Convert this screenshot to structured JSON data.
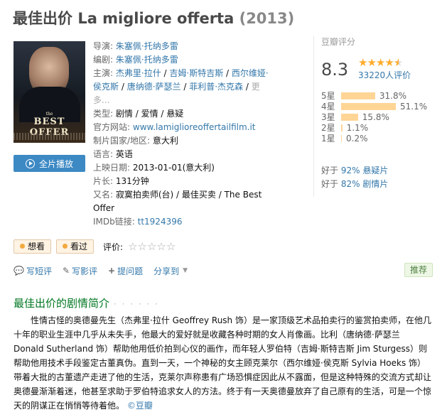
{
  "title": {
    "cn": "最佳出价",
    "original": "La migliore offerta",
    "year": "(2013)"
  },
  "poster": {
    "title_small": "the",
    "title_big": "BEST OFFER"
  },
  "play_button": "全片播放",
  "info": {
    "director_label": "导演:",
    "director": "朱塞佩·托纳多雷",
    "writer_label": "编剧:",
    "writer": "朱塞佩·托纳多雷",
    "cast_label": "主演:",
    "cast": [
      "杰弗里·拉什",
      "吉姆·斯特吉斯",
      "西尔维娅·侯克斯",
      "唐纳德·萨瑟兰",
      "菲利普·杰克森"
    ],
    "cast_more": "更多...",
    "genre_label": "类型:",
    "genres": [
      "剧情",
      "爱情",
      "悬疑"
    ],
    "site_label": "官方网站:",
    "site": "www.lamiglioreoffertailfilm.it",
    "country_label": "制片国家/地区:",
    "country": "意大利",
    "language_label": "语言:",
    "language": "英语",
    "release_label": "上映日期:",
    "release": "2013-01-01(意大利)",
    "runtime_label": "片长:",
    "runtime": "131分钟",
    "aka_label": "又名:",
    "aka": "寂寞拍卖师(台) / 最佳买卖 / The Best Offer",
    "imdb_label": "IMDb链接:",
    "imdb": "tt1924396"
  },
  "rating": {
    "label": "豆瓣评分",
    "score": "8.3",
    "stars_value": 4.5,
    "votes": "33220人评价",
    "bars": [
      {
        "label": "5星",
        "percent": 31.8,
        "text": "31.8%"
      },
      {
        "label": "4星",
        "percent": 51.1,
        "text": "51.1%"
      },
      {
        "label": "3星",
        "percent": 15.8,
        "text": "15.8%"
      },
      {
        "label": "2星",
        "percent": 1.1,
        "text": "1.1%"
      },
      {
        "label": "1星",
        "percent": 0.2,
        "text": "0.2%"
      }
    ],
    "better_than": [
      {
        "prefix": "好于 ",
        "percent": "92%",
        "genre": "悬疑片"
      },
      {
        "prefix": "好于 ",
        "percent": "82%",
        "genre": "剧情片"
      }
    ]
  },
  "actions": {
    "want": "想看",
    "seen": "看过",
    "rate_label": "评价:",
    "rate_stars": "☆☆☆☆☆"
  },
  "toolbar": {
    "short_review": "写短评",
    "review": "写影评",
    "ask": "提问题",
    "share": "分享到",
    "recommend": "推荐"
  },
  "intro": {
    "title": "最佳出价的剧情简介",
    "dots": "· · · · · ·",
    "text": "性情古怪的奥德曼先生（杰弗里·拉什 Geoffrey Rush 饰）是一家顶级艺术品拍卖行的鉴赏拍卖师，在他几十年的职业生涯中几乎从未失手，他最大的爱好就是收藏各种时期的女人肖像画。比利（唐纳德·萨瑟兰 Donald Sutherland 饰）帮助他用低价拍到心仪的画作，而年轻人罗伯特（吉姆·斯特吉斯 Jim Sturgess）则帮助他用技术手段鉴定古董真伪。直到一天，一个神秘的女主顾克莱尔（西尔维娅·侯克斯 Sylvia Hoeks 饰）带着大批的古董遗产走进了他的生活，克莱尔声称患有广场恐惧症因此从不露面，但是这种特殊的交流方式却让奥德曼渐渐着迷，他甚至求助于罗伯特追求女人的方法。终于有一天奥德曼放弃了自己原有的生活，可是一个惊天的阴谋正在悄悄等待着他。",
    "source": "©豆瓣"
  }
}
